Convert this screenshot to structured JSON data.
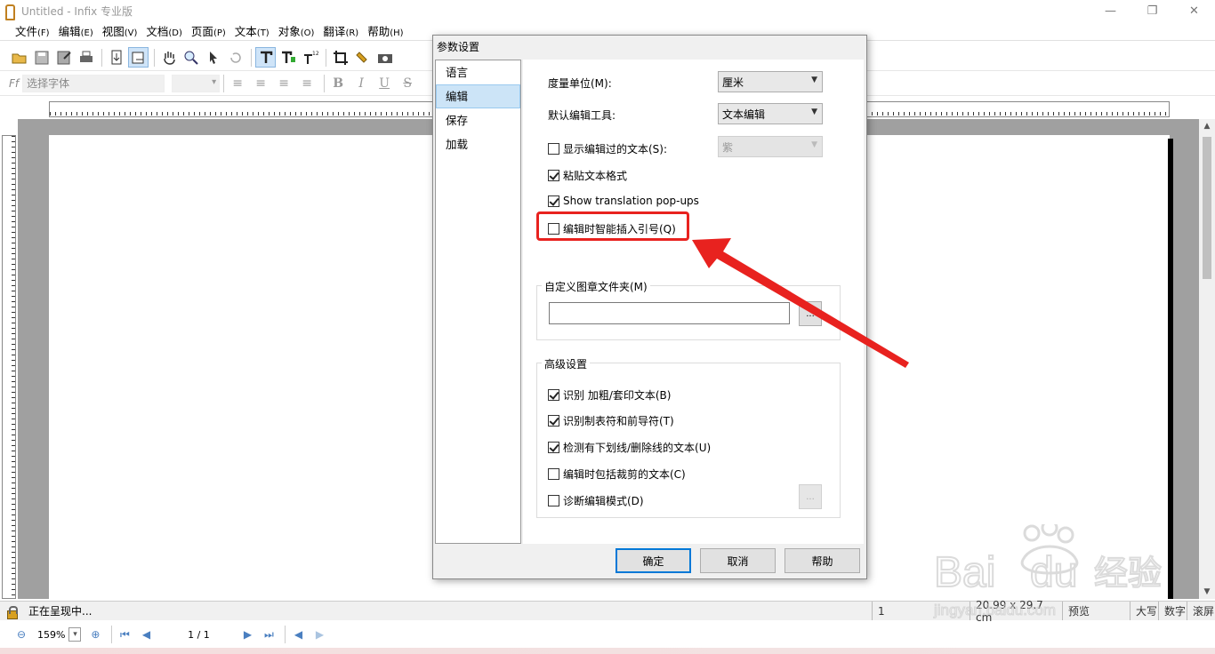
{
  "window": {
    "title": "Untitled - Infix 专业版",
    "minimize": "—",
    "maximize": "❐",
    "close": "✕"
  },
  "menu": {
    "items": [
      {
        "label": "文件",
        "acc": "(F)"
      },
      {
        "label": "编辑",
        "acc": "(E)"
      },
      {
        "label": "视图",
        "acc": "(V)"
      },
      {
        "label": "文档",
        "acc": "(D)"
      },
      {
        "label": "页面",
        "acc": "(P)"
      },
      {
        "label": "文本",
        "acc": "(T)"
      },
      {
        "label": "对象",
        "acc": "(O)"
      },
      {
        "label": "翻译",
        "acc": "(R)"
      },
      {
        "label": "帮助",
        "acc": "(H)"
      }
    ]
  },
  "format_toolbar": {
    "font_placeholder": "选择字体",
    "bold": "B",
    "italic": "I",
    "underline": "U",
    "strike": "S"
  },
  "dialog": {
    "title": "参数设置",
    "categories": [
      "语言",
      "编辑",
      "保存",
      "加载"
    ],
    "selected_category": "编辑",
    "measure_unit_label": "度量单位(M):",
    "measure_unit_value": "厘米",
    "default_tool_label": "默认编辑工具:",
    "default_tool_value": "文本编辑",
    "show_edited_text": {
      "label": "显示编辑过的文本(S):",
      "checked": false
    },
    "edited_color_value": "紫",
    "paste_format": {
      "label": "粘贴文本格式",
      "checked": true
    },
    "translation_popups": {
      "label": "Show translation pop-ups",
      "checked": true
    },
    "smart_quotes": {
      "label": "编辑时智能插入引号(Q)",
      "checked": false
    },
    "stamp_folder_label": "自定义图章文件夹(M)",
    "stamp_folder_value": "",
    "browse_label": "...",
    "advanced_label": "高级设置",
    "advanced": [
      {
        "label": "识别 加粗/套印文本(B)",
        "checked": true
      },
      {
        "label": "识别制表符和前导符(T)",
        "checked": true
      },
      {
        "label": "检测有下划线/删除线的文本(U)",
        "checked": true
      },
      {
        "label": "编辑时包括裁剪的文本(C)",
        "checked": false
      },
      {
        "label": "诊断编辑模式(D)",
        "checked": false
      }
    ],
    "ok": "确定",
    "cancel": "取消",
    "help": "帮助"
  },
  "status": {
    "text": "正在呈现中...",
    "page_field": "1",
    "size_field": "20.99 x 29.7 cm",
    "mode": "预览",
    "caps": "大写",
    "num": "数字",
    "scroll": "滚屏"
  },
  "nav": {
    "zoom": "159%",
    "page": "1 / 1"
  },
  "colors": {
    "accent": "#0078d7",
    "annotation": "#e8221f",
    "selection": "#cce4f7"
  }
}
